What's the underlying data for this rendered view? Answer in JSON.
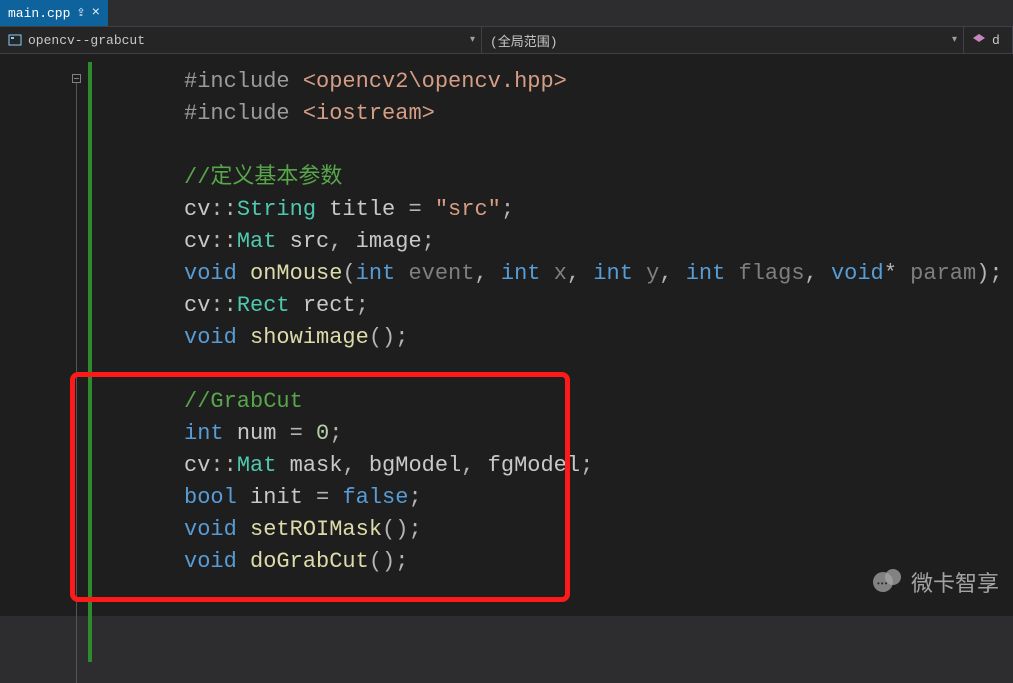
{
  "tab": {
    "filename": "main.cpp"
  },
  "nav": {
    "project": "opencv--grabcut",
    "scope": "(全局范围)",
    "member_prefix": "d"
  },
  "code": {
    "include1_kw": "#include",
    "include1_hdr": "<opencv2\\opencv.hpp>",
    "include2_kw": "#include",
    "include2_hdr": "<iostream>",
    "cmt1": "//定义基本参数",
    "ns": "cv",
    "t_string": "String",
    "v_title": "title",
    "eq": "=",
    "s_src": "\"src\"",
    "t_mat": "Mat",
    "v_src": "src",
    "v_image": "image",
    "t_void": "void",
    "f_onmouse": "onMouse",
    "t_int": "int",
    "p_event": "event",
    "p_x": "x",
    "p_y": "y",
    "p_flags": "flags",
    "p_param": "param",
    "star": "*",
    "t_rect": "Rect",
    "v_rect": "rect",
    "f_showimage": "showimage",
    "cmt2": "//GrabCut",
    "v_num": "num",
    "n_zero": "0",
    "v_mask": "mask",
    "v_bg": "bgModel",
    "v_fg": "fgModel",
    "t_bool": "bool",
    "v_init": "init",
    "kw_false": "false",
    "f_setroi": "setROIMask",
    "f_dograb": "doGrabCut",
    "semi": ";",
    "comma": ",",
    "dcolon": "::",
    "lp": "(",
    "rp": ")"
  },
  "watermark": "微卡智享"
}
